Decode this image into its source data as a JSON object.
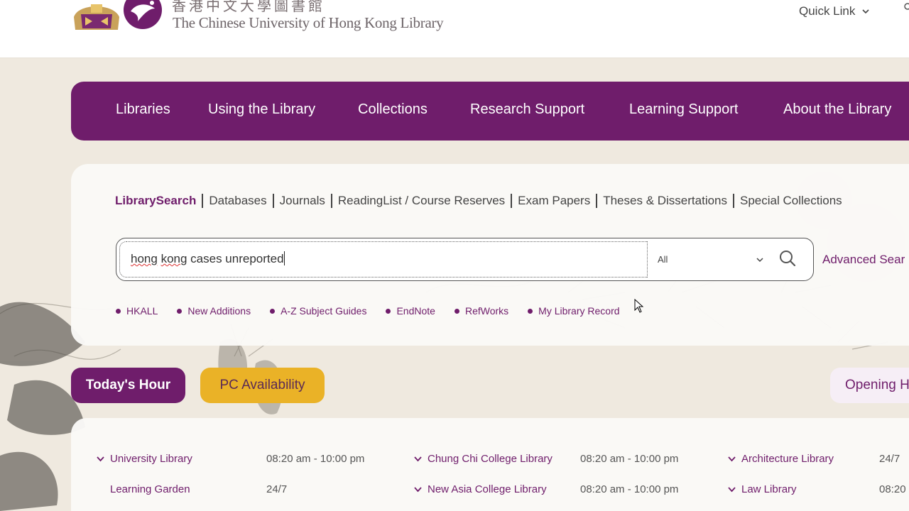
{
  "header": {
    "logo_chinese": "香港中文大學圖書館",
    "logo_english": "The Chinese University of Hong Kong Library",
    "quick_link": "Quick Link"
  },
  "nav": {
    "items": [
      "Libraries",
      "Using the Library",
      "Collections",
      "Research Support",
      "Learning Support",
      "About the Library"
    ]
  },
  "search": {
    "tabs": [
      "LibrarySearch",
      "Databases",
      "Journals",
      "ReadingList / Course Reserves",
      "Exam Papers",
      "Theses & Dissertations",
      "Special Collections"
    ],
    "active_tab": "LibrarySearch",
    "query_part1": "hong",
    "query_part2": " ",
    "query_part3": "kong",
    "query_part4": " cases ",
    "query_part5": "unreported",
    "scope": "All",
    "advanced_label": "Advanced Sear",
    "quick_links": [
      "HKALL",
      "New Additions",
      "A-Z Subject Guides",
      "EndNote",
      "RefWorks",
      "My Library Record"
    ]
  },
  "hours_buttons": {
    "today": "Today's Hour",
    "pc": "PC Availability",
    "opening": "Opening H"
  },
  "hours": {
    "col1": [
      {
        "name": "University Library",
        "time": "08:20 am - 10:00 pm",
        "expandable": true
      },
      {
        "name": "Learning Garden",
        "time": "24/7",
        "expandable": false
      }
    ],
    "col2": [
      {
        "name": "Chung Chi College Library",
        "time": "08:20 am - 10:00 pm",
        "expandable": true
      },
      {
        "name": "New Asia College Library",
        "time": "08:20 am - 10:00 pm",
        "expandable": true
      }
    ],
    "col3": [
      {
        "name": "Architecture Library",
        "time": "24/7",
        "expandable": true
      },
      {
        "name": "Law Library",
        "time": "08:20",
        "expandable": true
      }
    ]
  },
  "colors": {
    "brand_purple": "#6f1d6b",
    "accent_gold": "#eab227",
    "background": "#efe9df"
  }
}
